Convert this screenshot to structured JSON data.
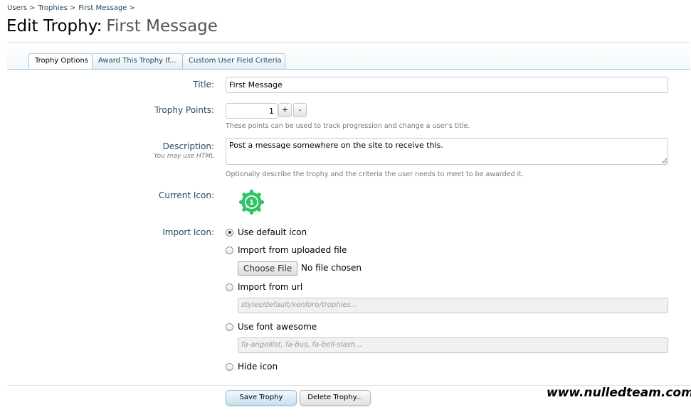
{
  "breadcrumb": [
    {
      "label": "Users",
      "sep": ">"
    },
    {
      "label": "Trophies",
      "sep": ">"
    },
    {
      "label": "First Message",
      "sep": ">"
    }
  ],
  "page_title": {
    "phrase": "Edit Trophy:",
    "name": "First Message"
  },
  "tabs": [
    {
      "label": "Trophy Options",
      "active": true
    },
    {
      "label": "Award This Trophy If...",
      "active": false
    },
    {
      "label": "Custom User Field Criteria",
      "active": false
    }
  ],
  "form": {
    "title": {
      "label": "Title:",
      "value": "First Message"
    },
    "points": {
      "label": "Trophy Points:",
      "value": "1",
      "increment": "+",
      "decrement": "-",
      "explain": "These points can be used to track progression and change a user's title."
    },
    "description": {
      "label": "Description:",
      "hint": "You may use HTML",
      "value": "Post a message somewhere on the site to receive this.",
      "explain": "Optionally describe the trophy and the criteria the user needs to meet to be awarded it."
    },
    "current_icon": {
      "label": "Current Icon:",
      "icon": "trophy-badge-icon",
      "badge_text": "1",
      "color": "#2ec464"
    },
    "import_icon": {
      "label": "Import Icon:",
      "options": {
        "default": "Use default icon",
        "uploaded": "Import from uploaded file",
        "url": "Import from url",
        "font_awesome": "Use font awesome",
        "hide": "Hide icon"
      },
      "selected": "default",
      "file_button": "Choose File",
      "file_status": "No file chosen",
      "url_placeholder": "styles/default/xenforo/trophies...",
      "fa_placeholder": "fa-angellist, fa-bus, fa-bell-slash..."
    }
  },
  "buttons": {
    "save": "Save Trophy",
    "delete": "Delete Trophy..."
  },
  "watermark": "www.nulledteam.com",
  "colors": {
    "link": "#2b485c",
    "tab_border": "#a9c7dc",
    "badge": "#2ec464"
  }
}
